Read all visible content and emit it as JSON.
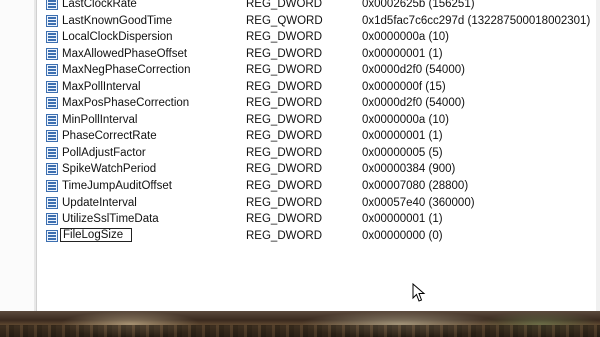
{
  "values": [
    {
      "name": "LastClockRate",
      "type": "REG_DWORD",
      "data": "0x0002625b (156251)"
    },
    {
      "name": "LastKnownGoodTime",
      "type": "REG_QWORD",
      "data": "0x1d5fac7c6cc297d (132287500018002301)"
    },
    {
      "name": "LocalClockDispersion",
      "type": "REG_DWORD",
      "data": "0x0000000a (10)"
    },
    {
      "name": "MaxAllowedPhaseOffset",
      "type": "REG_DWORD",
      "data": "0x00000001 (1)"
    },
    {
      "name": "MaxNegPhaseCorrection",
      "type": "REG_DWORD",
      "data": "0x0000d2f0 (54000)"
    },
    {
      "name": "MaxPollInterval",
      "type": "REG_DWORD",
      "data": "0x0000000f (15)"
    },
    {
      "name": "MaxPosPhaseCorrection",
      "type": "REG_DWORD",
      "data": "0x0000d2f0 (54000)"
    },
    {
      "name": "MinPollInterval",
      "type": "REG_DWORD",
      "data": "0x0000000a (10)"
    },
    {
      "name": "PhaseCorrectRate",
      "type": "REG_DWORD",
      "data": "0x00000001 (1)"
    },
    {
      "name": "PollAdjustFactor",
      "type": "REG_DWORD",
      "data": "0x00000005 (5)"
    },
    {
      "name": "SpikeWatchPeriod",
      "type": "REG_DWORD",
      "data": "0x00000384 (900)"
    },
    {
      "name": "TimeJumpAuditOffset",
      "type": "REG_DWORD",
      "data": "0x00007080 (28800)"
    },
    {
      "name": "UpdateInterval",
      "type": "REG_DWORD",
      "data": "0x00057e40 (360000)"
    },
    {
      "name": "UtilizeSslTimeData",
      "type": "REG_DWORD",
      "data": "0x00000001 (1)"
    }
  ],
  "editing": {
    "name": "FileLogSize",
    "type": "REG_DWORD",
    "data": "0x00000000 (0)"
  },
  "icons": {
    "value": "registry-binary-value-icon",
    "cursor": "mouse-pointer-icon"
  },
  "colors": {
    "icon_blue": "#3d6fb0",
    "text": "#111111",
    "background": "#ffffff"
  }
}
